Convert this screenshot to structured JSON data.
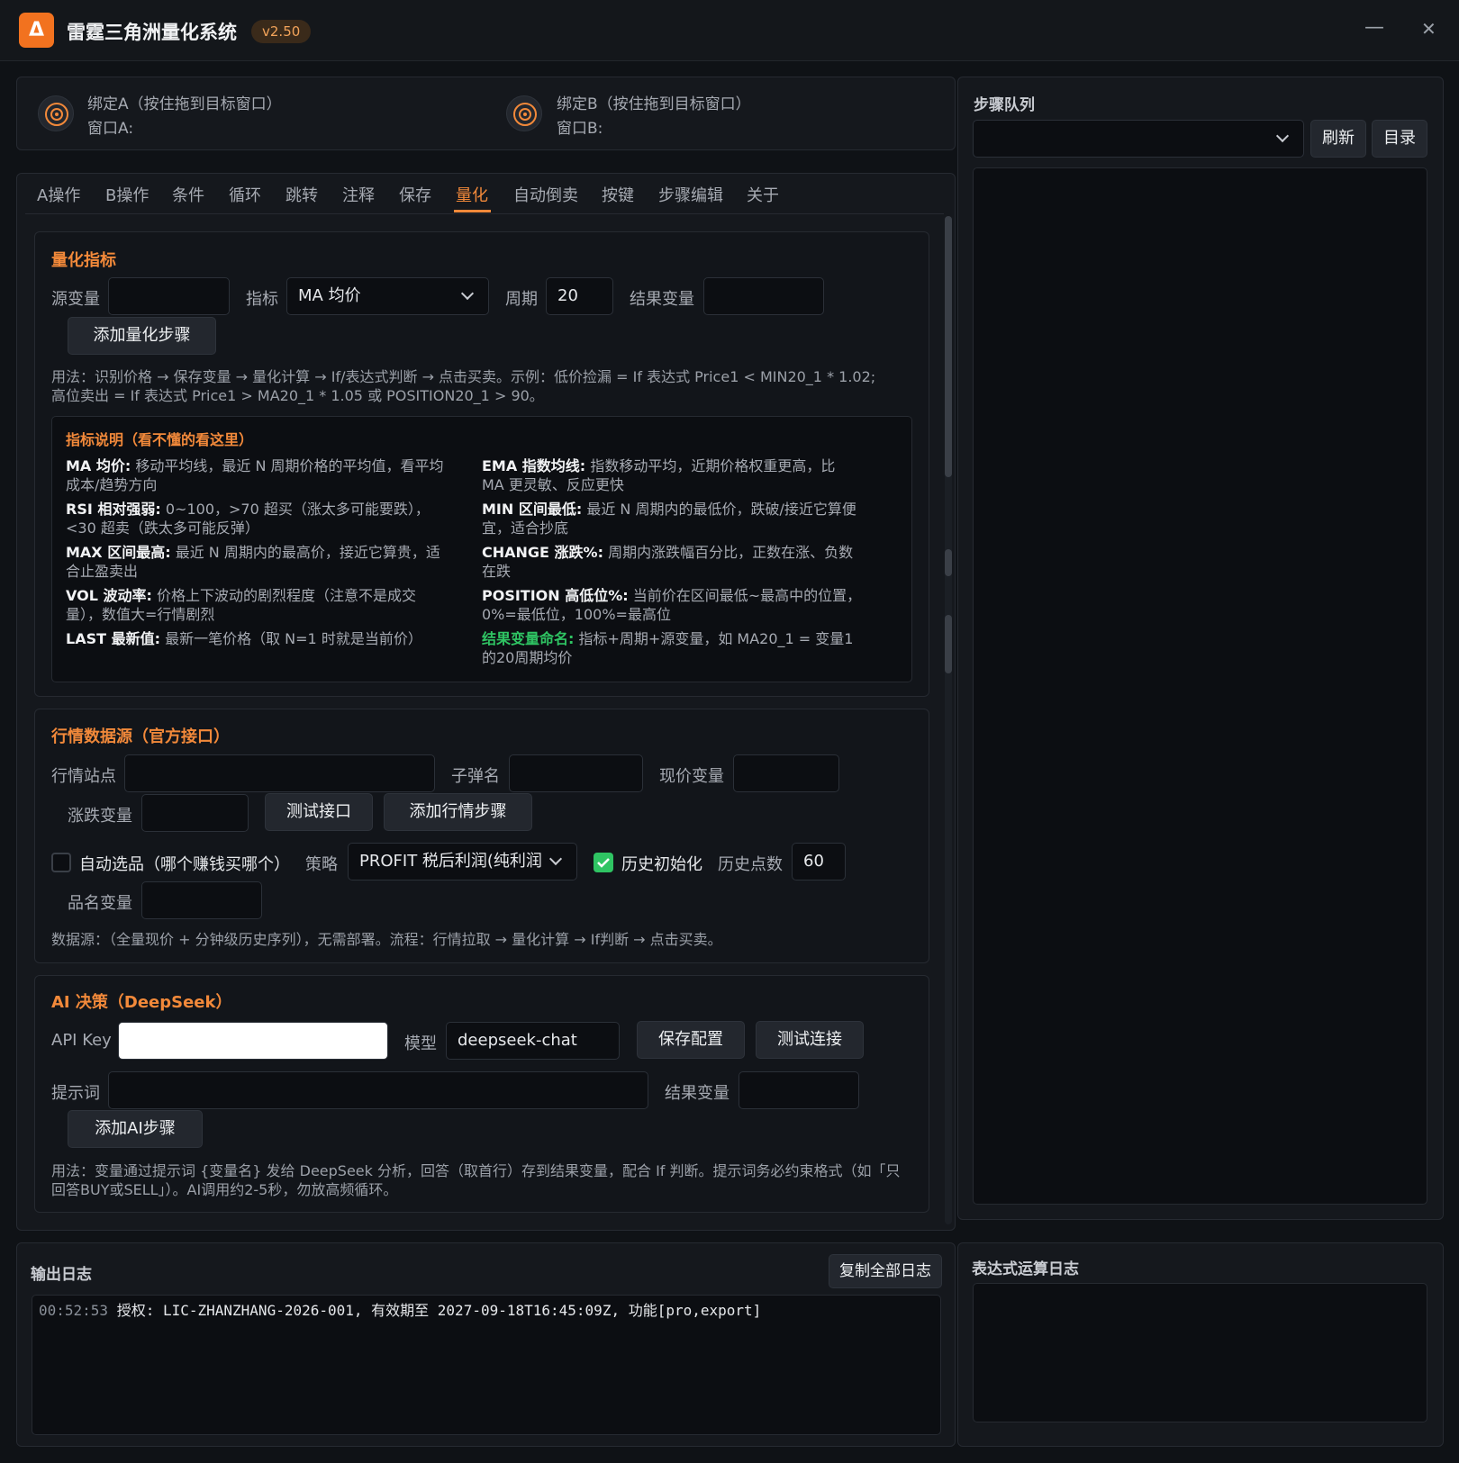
{
  "app": {
    "logo_glyph": "Δ",
    "title": "雷霆三角洲量化系统",
    "version": "v2.50",
    "minimize_glyph": "—",
    "close_glyph": "✕"
  },
  "bind": {
    "a_label": "绑定A（按住拖到目标窗口）",
    "a_window": "窗口A:",
    "b_label": "绑定B（按住拖到目标窗口）",
    "b_window": "窗口B:"
  },
  "tabs": [
    "A操作",
    "B操作",
    "条件",
    "循环",
    "跳转",
    "注释",
    "保存",
    "量化",
    "自动倒卖",
    "按键",
    "步骤编辑",
    "关于"
  ],
  "active_tab": "量化",
  "quant": {
    "title": "量化指标",
    "source_label": "源变量",
    "source_value": "",
    "indicator_label": "指标",
    "indicator_value": "MA 均价",
    "period_label": "周期",
    "period_value": "20",
    "result_label": "结果变量",
    "result_value": "",
    "add_button": "添加量化步骤",
    "usage_line1": "用法：识别价格 → 保存变量 → 量化计算 → If/表达式判断 → 点击买卖。示例：低价捡漏 = If 表达式 Price1 < MIN20_1 * 1.02;",
    "usage_line2": "高位卖出 = If 表达式 Price1 > MA20_1 * 1.05 或 POSITION20_1 > 90。"
  },
  "indicators": {
    "title": "指标说明（看不懂的看这里）",
    "left": [
      {
        "key": "MA 均价:",
        "l1": "移动平均线，最近 N 周期价格的平均值，看平均",
        "l2": "成本/趋势方向"
      },
      {
        "key": "RSI 相对强弱:",
        "l1": "0~100，>70 超买（涨太多可能要跌），",
        "l2": "<30 超卖（跌太多可能反弹）"
      },
      {
        "key": "MAX 区间最高:",
        "l1": "最近 N 周期内的最高价，接近它算贵，适",
        "l2": "合止盈卖出"
      },
      {
        "key": "VOL 波动率:",
        "l1": "价格上下波动的剧烈程度（注意不是成交",
        "l2": "量），数值大=行情剧烈"
      },
      {
        "key": "LAST 最新值:",
        "l1": "最新一笔价格（取 N=1 时就是当前价）",
        "l2": ""
      }
    ],
    "right": [
      {
        "key": "EMA 指数均线:",
        "l1": "指数移动平均，近期价格权重更高，比",
        "l2": "MA 更灵敏、反应更快"
      },
      {
        "key": "MIN 区间最低:",
        "l1": "最近 N 周期内的最低价，跌破/接近它算便",
        "l2": "宜，适合抄底"
      },
      {
        "key": "CHANGE 涨跌%:",
        "l1": "周期内涨跌幅百分比，正数在涨、负数",
        "l2": "在跌"
      },
      {
        "key": "POSITION 高低位%:",
        "l1": "当前价在区间最低~最高中的位置，",
        "l2": "0%=最低位，100%=最高位"
      },
      {
        "key": "结果变量命名:",
        "l1": "指标+周期+源变量，如 MA20_1 = 变量1",
        "l2": "的20周期均价"
      }
    ]
  },
  "market": {
    "title": "行情数据源（官方接口）",
    "site_label": "行情站点",
    "site_value": "",
    "bullet_label": "子弹名",
    "bullet_value": "",
    "price_label": "现价变量",
    "price_value": "",
    "change_label": "涨跌变量",
    "change_value": "",
    "test_button": "测试接口",
    "add_button": "添加行情步骤",
    "auto_select_label": "自动选品（哪个赚钱买哪个）",
    "auto_select_checked": false,
    "strategy_label": "策略",
    "strategy_value": "PROFIT 税后利润(纯利润",
    "history_init_label": "历史初始化",
    "history_init_checked": true,
    "history_points_label": "历史点数",
    "history_points_value": "60",
    "item_label": "品名变量",
    "item_value": "",
    "hint": "数据源：（全量现价 + 分钟级历史序列），无需部署。流程：行情拉取 → 量化计算 → If判断 → 点击买卖。"
  },
  "ai": {
    "title": "AI 决策（DeepSeek）",
    "api_key_label": "API Key",
    "api_key_value": "",
    "model_label": "模型",
    "model_value": "deepseek-chat",
    "save_button": "保存配置",
    "test_button": "测试连接",
    "prompt_label": "提示词",
    "prompt_value": "",
    "result_label": "结果变量",
    "result_value": "",
    "add_button": "添加AI步骤",
    "usage_line1": "用法：变量通过提示词 {变量名} 发给 DeepSeek 分析，回答（取首行）存到结果变量，配合 If 判断。提示词务必约束格式（如「只",
    "usage_line2": "回答BUY或SELL」）。AI调用约2-5秒，勿放高频循环。"
  },
  "steps": {
    "title": "步骤队列",
    "select_value": "",
    "refresh_button": "刷新",
    "catalog_button": "目录"
  },
  "log": {
    "title": "输出日志",
    "copy_button": "复制全部日志",
    "entries": [
      {
        "time": "00:52:53",
        "text": "授权: LIC-ZHANZHANG-2026-001, 有效期至 2027-09-18T16:45:09Z, 功能[pro,export]"
      }
    ]
  },
  "expr_log": {
    "title": "表达式运算日志"
  },
  "colors": {
    "accent": "#f2893a",
    "logo": "#f2721f",
    "green": "#2fc463",
    "background": "#0f1216"
  }
}
